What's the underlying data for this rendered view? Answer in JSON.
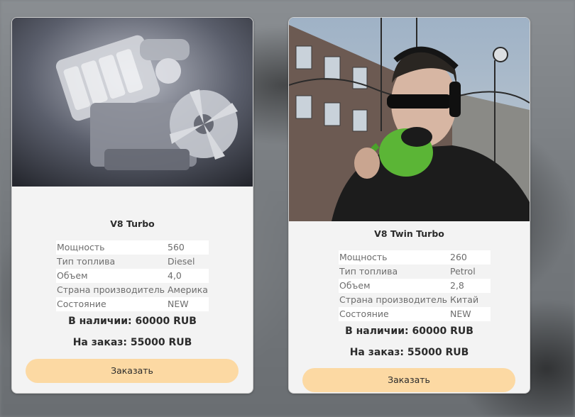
{
  "products": [
    {
      "photo": "engine-photo",
      "name": "V8 Turbo",
      "specs": [
        {
          "label": "Мощность",
          "value": "560"
        },
        {
          "label": "Тип топлива",
          "value": "Diesel"
        },
        {
          "label": "Объем",
          "value": "4,0"
        },
        {
          "label": "Страна производитель",
          "value": "Америка"
        },
        {
          "label": "Состояние",
          "value": "NEW"
        }
      ],
      "in_stock": "В наличии: 60000 RUB",
      "on_order": "На заказ: 55000 RUB",
      "button": "Заказать"
    },
    {
      "photo": "person-with-mug-photo",
      "name": "V8 Twin Turbo",
      "specs": [
        {
          "label": "Мощность",
          "value": "260"
        },
        {
          "label": "Тип топлива",
          "value": "Petrol"
        },
        {
          "label": "Объем",
          "value": "2,8"
        },
        {
          "label": "Страна производитель",
          "value": "Китай"
        },
        {
          "label": "Состояние",
          "value": "NEW"
        }
      ],
      "in_stock": "В наличии: 60000 RUB",
      "on_order": "На заказ: 55000 RUB",
      "button": "Заказать"
    }
  ],
  "colors": {
    "card_bg": "#f3f3f3",
    "button_bg": "#fcd9a3",
    "text_dark": "#2b2b2b",
    "text_muted": "#6d6d6d"
  }
}
